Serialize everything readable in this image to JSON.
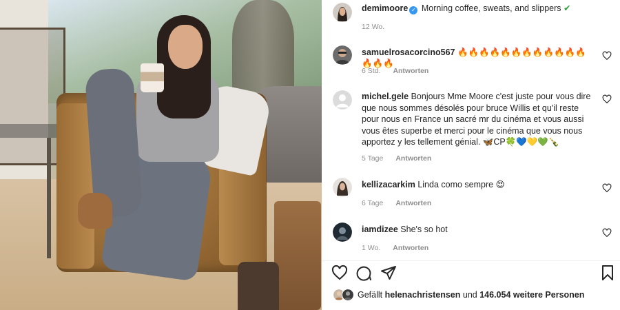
{
  "post": {
    "author": "demimoore",
    "caption": "Morning coffee, sweats, and slippers",
    "caption_emoji": "✔",
    "age": "12 Wo."
  },
  "comments": [
    {
      "user": "samuelrosacorcino567",
      "text": "🔥🔥🔥🔥🔥🔥🔥🔥🔥🔥🔥🔥🔥🔥🔥",
      "age": "6 Std.",
      "reply": "Antworten"
    },
    {
      "user": "michel.gele",
      "text": "Bonjours Mme Moore c'est juste pour vous dire que nous sommes désolés pour bruce Willis et qu'il reste pour nous en France un sacré mr du cinéma et vous aussi vous êtes superbe et merci pour le cinéma que vous nous apportez y les tellement génial. 🦋CP🍀💙💛💚🍾",
      "age": "5 Tage",
      "reply": "Antworten"
    },
    {
      "user": "kellizacarkim",
      "text": "Linda como sempre 😍",
      "age": "6 Tage",
      "reply": "Antworten"
    },
    {
      "user": "iamdizee",
      "text": "She's so hot",
      "age": "1 Wo.",
      "reply": "Antworten"
    }
  ],
  "likes": {
    "prefix": "Gefällt",
    "user": "helenachristensen",
    "connector": "und",
    "others": "146.054 weitere Personen"
  },
  "icons": {
    "like": "heart-icon",
    "comment": "comment-icon",
    "share": "share-icon",
    "save": "bookmark-icon",
    "comment_like": "heart-outline-icon"
  },
  "colors": {
    "verified": "#3897f0",
    "text": "#262626",
    "secondary": "#8e8e8e"
  }
}
